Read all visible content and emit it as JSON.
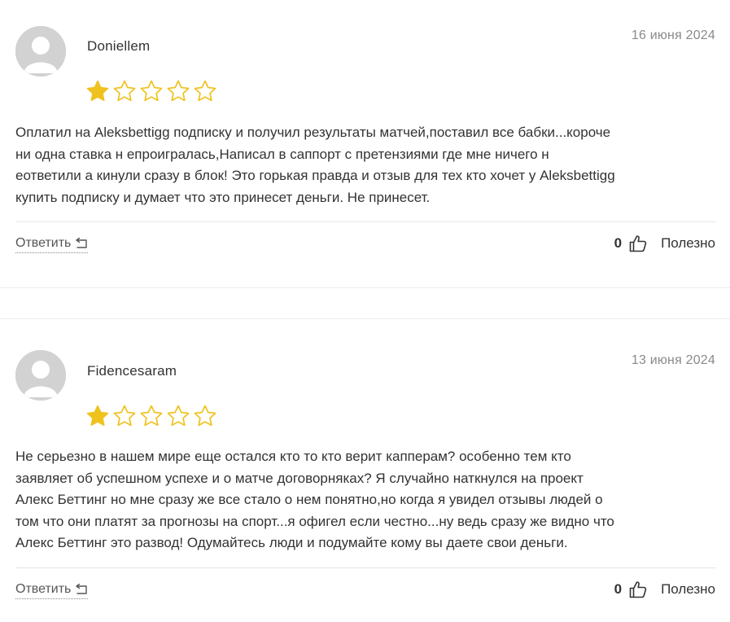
{
  "colors": {
    "star_filled": "#EFC21E",
    "star_empty_stroke": "#EFC21E",
    "date": "#8a8a8a",
    "text": "#333333"
  },
  "reviews": [
    {
      "author": "Doniellem",
      "date": "16 июня 2024",
      "rating": 1,
      "rating_max": 5,
      "text_lines": [
        "Оплатил на Aleksbettigg подписку и получил результаты матчей,поставил все бабки...короче",
        "ни одна ставка н епроигралась,Написал в саппорт с претензиями где мне ничего н",
        "еответили а кинули сразу в блок! Это горькая правда и отзыв для тех кто хочет у Aleksbettigg",
        "купить подписку и думает что это принесет деньги. Не принесет."
      ],
      "reply_label": "Ответить",
      "helpful_count": "0",
      "helpful_label": "Полезно"
    },
    {
      "author": "Fidencesaram",
      "date": "13 июня 2024",
      "rating": 1,
      "rating_max": 5,
      "text_lines": [
        "Не серьезно в нашем мире еще остался кто то кто верит капперам? особенно тем кто",
        "заявляет об успешном успехе и о матче договорняках? Я случайно наткнулся на проект",
        "Алекс Беттинг но мне сразу же все стало о нем понятно,но когда я увидел отзывы людей о",
        "том что они платят за прогнозы на спорт...я офигел если честно...ну ведь сразу же видно что",
        "Алекс Беттинг это развод! Одумайтесь люди и подумайте кому вы даете свои деньги."
      ],
      "reply_label": "Ответить",
      "helpful_count": "0",
      "helpful_label": "Полезно"
    }
  ]
}
